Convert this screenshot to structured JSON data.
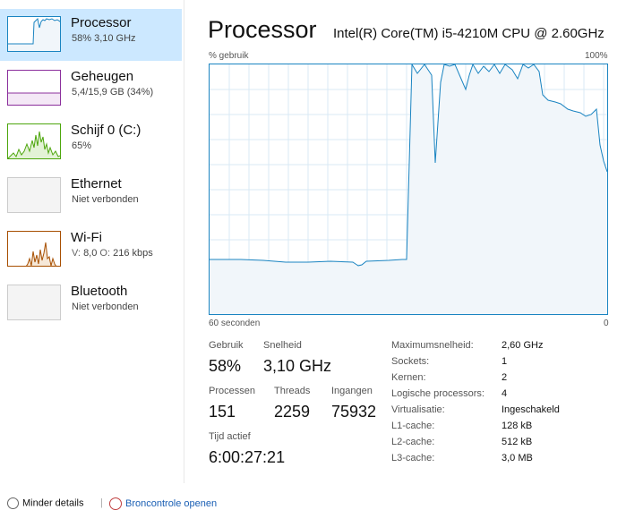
{
  "sidebar": {
    "items": [
      {
        "name": "Processor",
        "sub": "58% 3,10 GHz",
        "color": "#1a84c1"
      },
      {
        "name": "Geheugen",
        "sub": "5,4/15,9 GB (34%)",
        "color": "#8b2f9c"
      },
      {
        "name": "Schijf 0 (C:)",
        "sub": "65%",
        "color": "#4da60c"
      },
      {
        "name": "Ethernet",
        "sub": "Niet verbonden",
        "color": "#a0a0a0"
      },
      {
        "name": "Wi-Fi",
        "sub_prefix_s": "V:",
        "sub_s": "8,0",
        "sub_prefix_r": "O:",
        "sub_r": "216 kbps",
        "color": "#a74f01"
      },
      {
        "name": "Bluetooth",
        "sub": "Niet verbonden",
        "color": "#a0a0a0"
      }
    ]
  },
  "header": {
    "title": "Processor",
    "cpu_name": "Intel(R) Core(TM) i5-4210M CPU @ 2.60GHz"
  },
  "graph": {
    "ylabel": "% gebruik",
    "ymax_label": "100%",
    "xlabel_left": "60 seconden",
    "xlabel_right": "0",
    "line_color": "#1a84c1",
    "fill_color": "#f1f6fa"
  },
  "stats": {
    "usage_label": "Gebruik",
    "usage_value": "58%",
    "speed_label": "Snelheid",
    "speed_value": "3,10 GHz",
    "processes_label": "Processen",
    "processes_value": "151",
    "threads_label": "Threads",
    "threads_value": "2259",
    "handles_label": "Ingangen",
    "handles_value": "75932",
    "uptime_label": "Tijd actief",
    "uptime_value": "6:00:27:21"
  },
  "specs": [
    {
      "label": "Maximumsnelheid:",
      "value": "2,60 GHz"
    },
    {
      "label": "Sockets:",
      "value": "1"
    },
    {
      "label": "Kernen:",
      "value": "2"
    },
    {
      "label": "Logische processors:",
      "value": "4"
    },
    {
      "label": "Virtualisatie:",
      "value": "Ingeschakeld"
    },
    {
      "label": "L1-cache:",
      "value": "128 kB"
    },
    {
      "label": "L2-cache:",
      "value": "512 kB"
    },
    {
      "label": "L3-cache:",
      "value": "3,0 MB"
    }
  ],
  "footer": {
    "fewer_details": "Minder details",
    "open_monitor": "Broncontrole openen"
  }
}
